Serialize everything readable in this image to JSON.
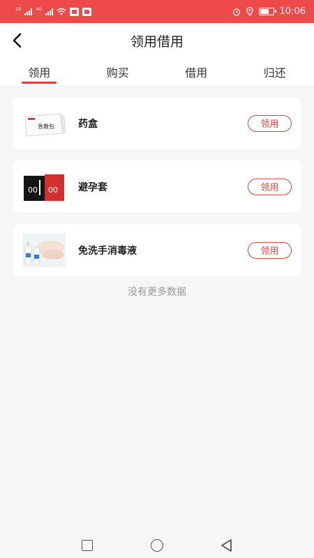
{
  "status_bar": {
    "sim1_label": "2G",
    "sim2_label": "4G",
    "time": "10:06"
  },
  "header": {
    "title": "领用借用",
    "back_icon": "back-arrow-icon"
  },
  "tabs": [
    {
      "label": "领用",
      "active": true
    },
    {
      "label": "购买",
      "active": false
    },
    {
      "label": "借用",
      "active": false
    },
    {
      "label": "归还",
      "active": false
    }
  ],
  "items": [
    {
      "name": "药盒",
      "action": "领用",
      "image": "medicine-box-image"
    },
    {
      "name": "避孕套",
      "action": "领用",
      "image": "condom-pack-image"
    },
    {
      "name": "免洗手消毒液",
      "action": "领用",
      "image": "hand-sanitizer-image"
    }
  ],
  "footer_text": "没有更多数据",
  "colors": {
    "status_bar": "#ef4a4a",
    "accent": "#e53935",
    "button_border": "#d9403a"
  },
  "nav_icons": [
    "recent-apps-icon",
    "home-icon",
    "back-icon"
  ]
}
